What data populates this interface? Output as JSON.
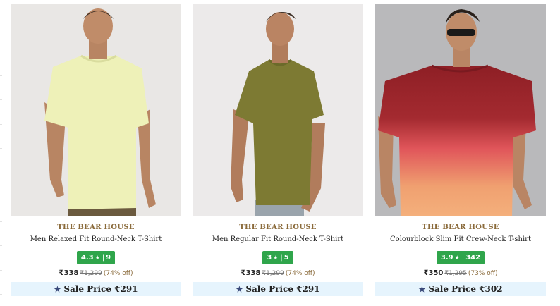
{
  "products": [
    {
      "brand": "THE BEAR HOUSE",
      "title": "Men Relaxed Fit Round-Neck T-Shirt",
      "rating": "4.3",
      "rating_count": "9",
      "price": "₹338",
      "mrp": "₹1,299",
      "discount": "(74% off)",
      "sale_price": "Sale Price ₹291",
      "shirt_color": "#eef1b8"
    },
    {
      "brand": "THE BEAR HOUSE",
      "title": "Men Regular Fit Round-Neck T-Shirt",
      "rating": "3",
      "rating_count": "5",
      "price": "₹338",
      "mrp": "₹1,299",
      "discount": "(74% off)",
      "sale_price": "Sale Price ₹291",
      "shirt_color": "#7d7a33"
    },
    {
      "brand": "THE BEAR HOUSE",
      "title": "Colourblock Slim Fit Crew-Neck T-shirt",
      "rating": "3.9",
      "rating_count": "342",
      "price": "₹350",
      "mrp": "₹1,295",
      "discount": "(73% off)",
      "sale_price": "Sale Price ₹302",
      "shirt_color": "#8e1f25"
    }
  ],
  "colors": {
    "brand": "#8a6a3a",
    "rating_badge": "#2fa54b",
    "sale_bg": "#e6f4fd"
  },
  "icons": {
    "rating_star": "star-icon",
    "sale_star": "star-icon"
  }
}
